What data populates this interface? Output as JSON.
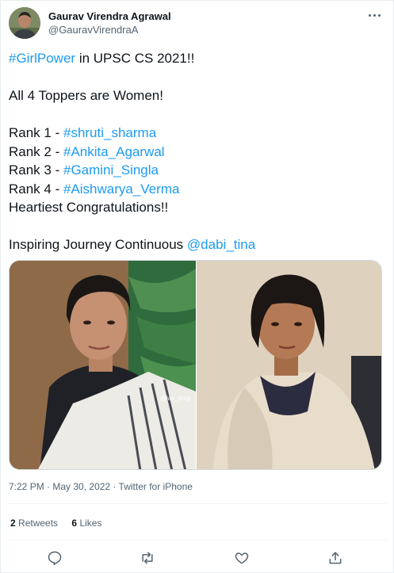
{
  "author": {
    "display_name": "Gaurav Virendra Agrawal",
    "handle": "@GauravVirendraA",
    "avatar_icon": "user-avatar"
  },
  "tweet": {
    "line1": {
      "tag": "#GirlPower",
      "rest": " in UPSC CS 2021!!"
    },
    "line2": "All 4 Toppers are Women!",
    "ranks": [
      {
        "prefix": "Rank 1 - ",
        "tag": "#shruti_sharma"
      },
      {
        "prefix": "Rank 2 - ",
        "tag": "#Ankita_Agarwal"
      },
      {
        "prefix": "Rank 3 - ",
        "tag": "#Gamini_Singla"
      },
      {
        "prefix": "Rank 4 - ",
        "tag": "#Aishwarya_Verma"
      }
    ],
    "congrats": "Heartiest Congratulations!!",
    "closing": {
      "text": "Inspiring Journey Continuous ",
      "mention": "@dabi_tina"
    }
  },
  "media": {
    "photo_left_watermark": "@ias_prep",
    "photos": [
      "photo-left",
      "photo-right"
    ]
  },
  "meta": {
    "time": "7:22 PM",
    "date": "May 30, 2022",
    "source": "Twitter for iPhone",
    "separator": " · "
  },
  "stats": {
    "retweets_count": "2",
    "retweets_label": "Retweets",
    "likes_count": "6",
    "likes_label": "Likes"
  },
  "actions": [
    "reply-icon",
    "retweet-icon",
    "like-icon",
    "share-icon"
  ],
  "colors": {
    "link": "#1d9bf0",
    "secondary_text": "#536471",
    "primary_text": "#0f1419",
    "divider": "#eff3f4"
  }
}
